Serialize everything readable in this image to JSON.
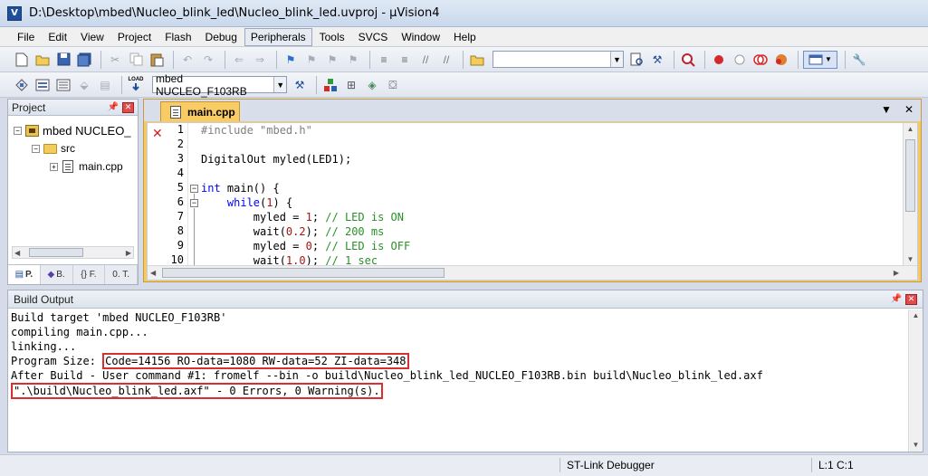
{
  "window": {
    "title": "D:\\Desktop\\mbed\\Nucleo_blink_led\\Nucleo_blink_led.uvproj - µVision4",
    "app_icon_letter": "V"
  },
  "menu": [
    "File",
    "Edit",
    "View",
    "Project",
    "Flash",
    "Debug",
    "Peripherals",
    "Tools",
    "SVCS",
    "Window",
    "Help"
  ],
  "toolbar": {
    "find_combo_value": "",
    "target_combo_value": "mbed NUCLEO_F103RB",
    "load_label": "LOAD"
  },
  "project_panel": {
    "title": "Project",
    "tree": {
      "root": "mbed NUCLEO_",
      "folder": "src",
      "file": "main.cpp"
    },
    "tabs": [
      "P.",
      "B.",
      "{} F.",
      "0. T."
    ]
  },
  "editor": {
    "tab_label": "main.cpp",
    "line_numbers": [
      "1",
      "2",
      "3",
      "4",
      "5",
      "6",
      "7",
      "8",
      "9",
      "10"
    ],
    "lines": {
      "l1_pp": "#include \"mbed.h\"",
      "l3": "DigitalOut myled(LED1);",
      "l5_kw": "int",
      "l5_rest": " main() {",
      "l6_indent": "    ",
      "l6_kw": "while",
      "l6_open": "(",
      "l6_num": "1",
      "l6_close": ") {",
      "l7_code": "        myled = ",
      "l7_num": "1",
      "l7_semi": "; ",
      "l7_cmt": "// LED is ON",
      "l8_code": "        wait(",
      "l8_num": "0.2",
      "l8_semi": "); ",
      "l8_cmt": "// 200 ms",
      "l9_code": "        myled = ",
      "l9_num": "0",
      "l9_semi": "; ",
      "l9_cmt": "// LED is OFF",
      "l10_code": "        wait(",
      "l10_num": "1.0",
      "l10_semi": "); ",
      "l10_cmt": "// 1 sec"
    }
  },
  "build_output": {
    "title": "Build Output",
    "line1": "Build target 'mbed NUCLEO_F103RB'",
    "line2": "compiling main.cpp...",
    "line3": "linking...",
    "line4_prefix": "Program Size: ",
    "line4_boxed": "Code=14156 RO-data=1080 RW-data=52 ZI-data=348",
    "line5": "After Build - User command #1: fromelf --bin -o build\\Nucleo_blink_led_NUCLEO_F103RB.bin build\\Nucleo_blink_led.axf",
    "line6_boxed": "\".\\build\\Nucleo_blink_led.axf\" - 0 Errors, 0 Warning(s)."
  },
  "status": {
    "debugger": "ST-Link Debugger",
    "position": "L:1 C:1"
  },
  "colors": {
    "editor_tab": "#f9cb64",
    "highlight_box": "#d9302f",
    "keyword": "#0000ff",
    "comment": "#2a8f2a",
    "number": "#a31515"
  }
}
